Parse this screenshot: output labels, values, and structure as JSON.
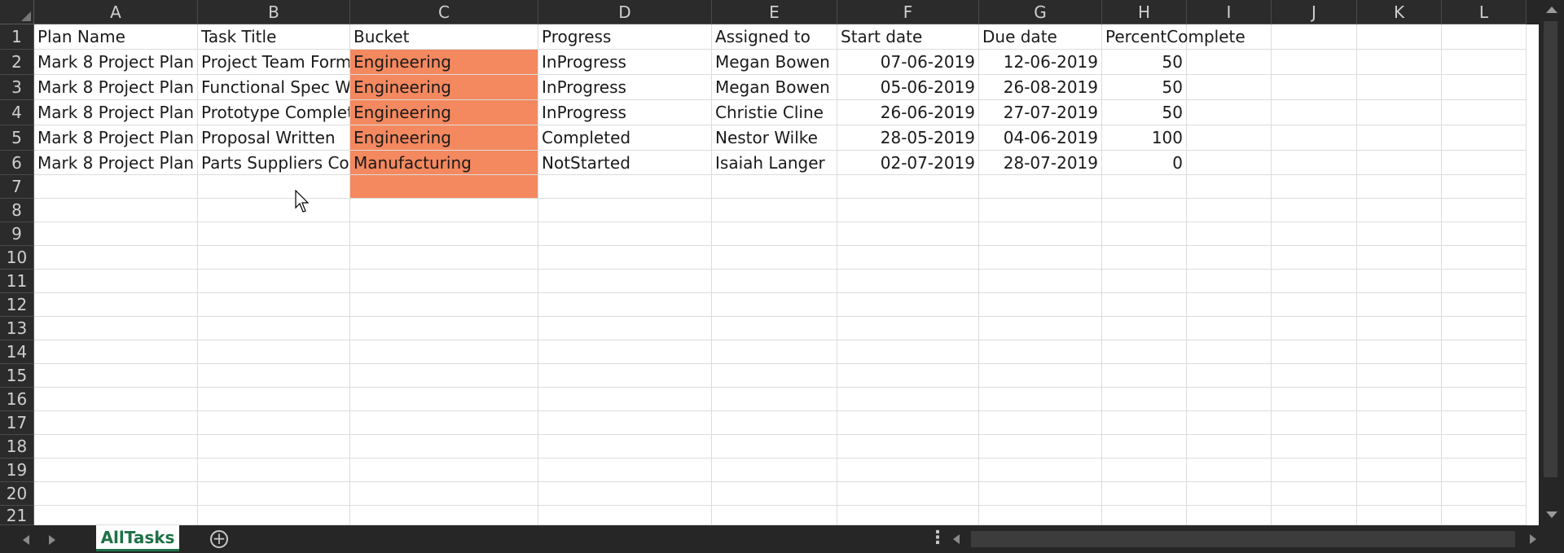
{
  "columns": [
    "A",
    "B",
    "C",
    "D",
    "E",
    "F",
    "G",
    "H",
    "I",
    "J",
    "K",
    "L"
  ],
  "rows": [
    "1",
    "2",
    "3",
    "4",
    "5",
    "6",
    "7",
    "8",
    "9",
    "10",
    "11",
    "12",
    "13",
    "14",
    "15",
    "16",
    "17",
    "18",
    "19",
    "20",
    "21"
  ],
  "header_row": {
    "A": "Plan Name",
    "B": "Task Title",
    "C": "Bucket",
    "D": "Progress",
    "E": "Assigned to",
    "F": "Start date",
    "G": "Due date",
    "H": "PercentComplete"
  },
  "data_rows": [
    {
      "A": "Mark 8 Project Plan",
      "B": "Project Team Form",
      "C": "Engineering",
      "D": "InProgress",
      "E": "Megan Bowen",
      "F": "07-06-2019",
      "G": "12-06-2019",
      "H": "50"
    },
    {
      "A": "Mark 8 Project Plan",
      "B": "Functional Spec W",
      "C": "Engineering",
      "D": "InProgress",
      "E": "Megan Bowen",
      "F": "05-06-2019",
      "G": "26-08-2019",
      "H": "50"
    },
    {
      "A": "Mark 8 Project Plan",
      "B": "Prototype Complet",
      "C": "Engineering",
      "D": "InProgress",
      "E": "Christie Cline",
      "F": "26-06-2019",
      "G": "27-07-2019",
      "H": "50"
    },
    {
      "A": "Mark 8 Project Plan",
      "B": "Proposal Written",
      "C": "Engineering",
      "D": "Completed",
      "E": "Nestor Wilke",
      "F": "28-05-2019",
      "G": "04-06-2019",
      "H": "100"
    },
    {
      "A": "Mark 8 Project Plan",
      "B": "Parts Suppliers Cor",
      "C": "Manufacturing",
      "D": "NotStarted",
      "E": "Isaiah Langer",
      "F": "02-07-2019",
      "G": "28-07-2019",
      "H": "0"
    }
  ],
  "sheet_tab": {
    "label": "AllTasks"
  },
  "colors": {
    "bucket_fill": "#f4885f",
    "tab_accent": "#1e7145",
    "header_bg": "#2b2b2b"
  },
  "icons": {
    "add_sheet": "plus-circle-icon",
    "scroll_left": "triangle-left-icon",
    "scroll_right": "triangle-right-icon",
    "more": "vertical-ellipsis-icon",
    "pointer": "mouse-pointer-icon"
  }
}
